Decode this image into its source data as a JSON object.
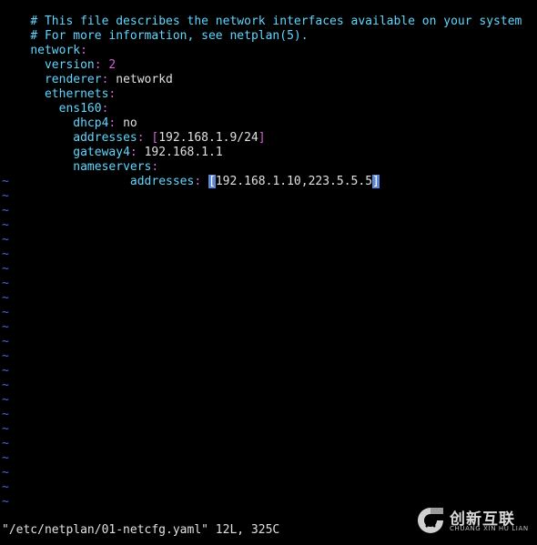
{
  "editor": {
    "lines": {
      "l1": "# This file describes the network interfaces available on your system",
      "l2": "# For more information, see netplan(5).",
      "network_key": "network",
      "version_key": "version",
      "version_val": "2",
      "renderer_key": "renderer",
      "renderer_val": "networkd",
      "ethernets_key": "ethernets",
      "ens160_key": "ens160",
      "dhcp4_key": "dhcp4",
      "dhcp4_val": "no",
      "addresses_key": "addresses",
      "addresses_val": "192.168.1.9/24",
      "gateway4_key": "gateway4",
      "gateway4_val": "192.168.1.1",
      "nameservers_key": "nameservers",
      "ns_addresses_key": "addresses",
      "ns_addresses_open": "[",
      "ns_addresses_val": "192.168.1.10,223.5.5.5",
      "ns_addresses_close": "]"
    },
    "tilde": "~",
    "status": "\"/etc/netplan/01-netcfg.yaml\" 12L, 325C"
  },
  "watermark": {
    "brand": "创新互联",
    "sub": "CHUANG XIN HU LIAN"
  },
  "colors": {
    "comment": "#5fd7ff",
    "punct": "#d75fd7",
    "tilde": "#3f6fd7",
    "highlight": "#5f87d7"
  }
}
